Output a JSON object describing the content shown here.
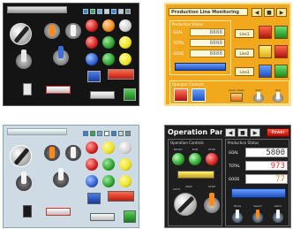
{
  "panels": {
    "dark_switches": {
      "title": "",
      "background": "#141414"
    },
    "production_monitor": {
      "title": "Production Line Monitoring",
      "section_label": "Production Status",
      "counters": [
        {
          "label": "GOAL",
          "value": "8888"
        },
        {
          "label": "TOTAL",
          "value": "8888"
        },
        {
          "label": "GOOD",
          "value": "8888"
        }
      ],
      "line_buttons": [
        "Line1",
        "Line2",
        "Line3"
      ],
      "bottom_label": "Operator Controls",
      "bottom_items": [
        "",
        "Alarm Status",
        "Start",
        "Stop"
      ],
      "background": "#f2a81d"
    },
    "light_switches": {
      "title": "",
      "background": "#cfdbe4"
    },
    "operation_panel": {
      "title": "Operation Panel",
      "power_label": "Power",
      "left_section": "Operation Controls",
      "right_section": "Production Status",
      "lamp_labels": [
        "READY",
        "RUN",
        "STOP"
      ],
      "knob_labels": [
        "AUTO",
        "MAN",
        "STOP"
      ],
      "counters": [
        {
          "label": "GOAL",
          "value": "5800"
        },
        {
          "label": "TOTAL",
          "value": "973"
        },
        {
          "label": "GOOD",
          "value": "77"
        }
      ],
      "switch_labels": [
        "Mode",
        "Select",
        "Alarm"
      ],
      "background": "#1e1e1e"
    }
  },
  "colors": {
    "red": "#d42020",
    "orange": "#f08a1a",
    "yellow": "#ece21e",
    "green": "#2aa22a",
    "blue": "#2c5fd0",
    "white": "#f4f4f4",
    "accent_blue": "#3f7fe6"
  }
}
